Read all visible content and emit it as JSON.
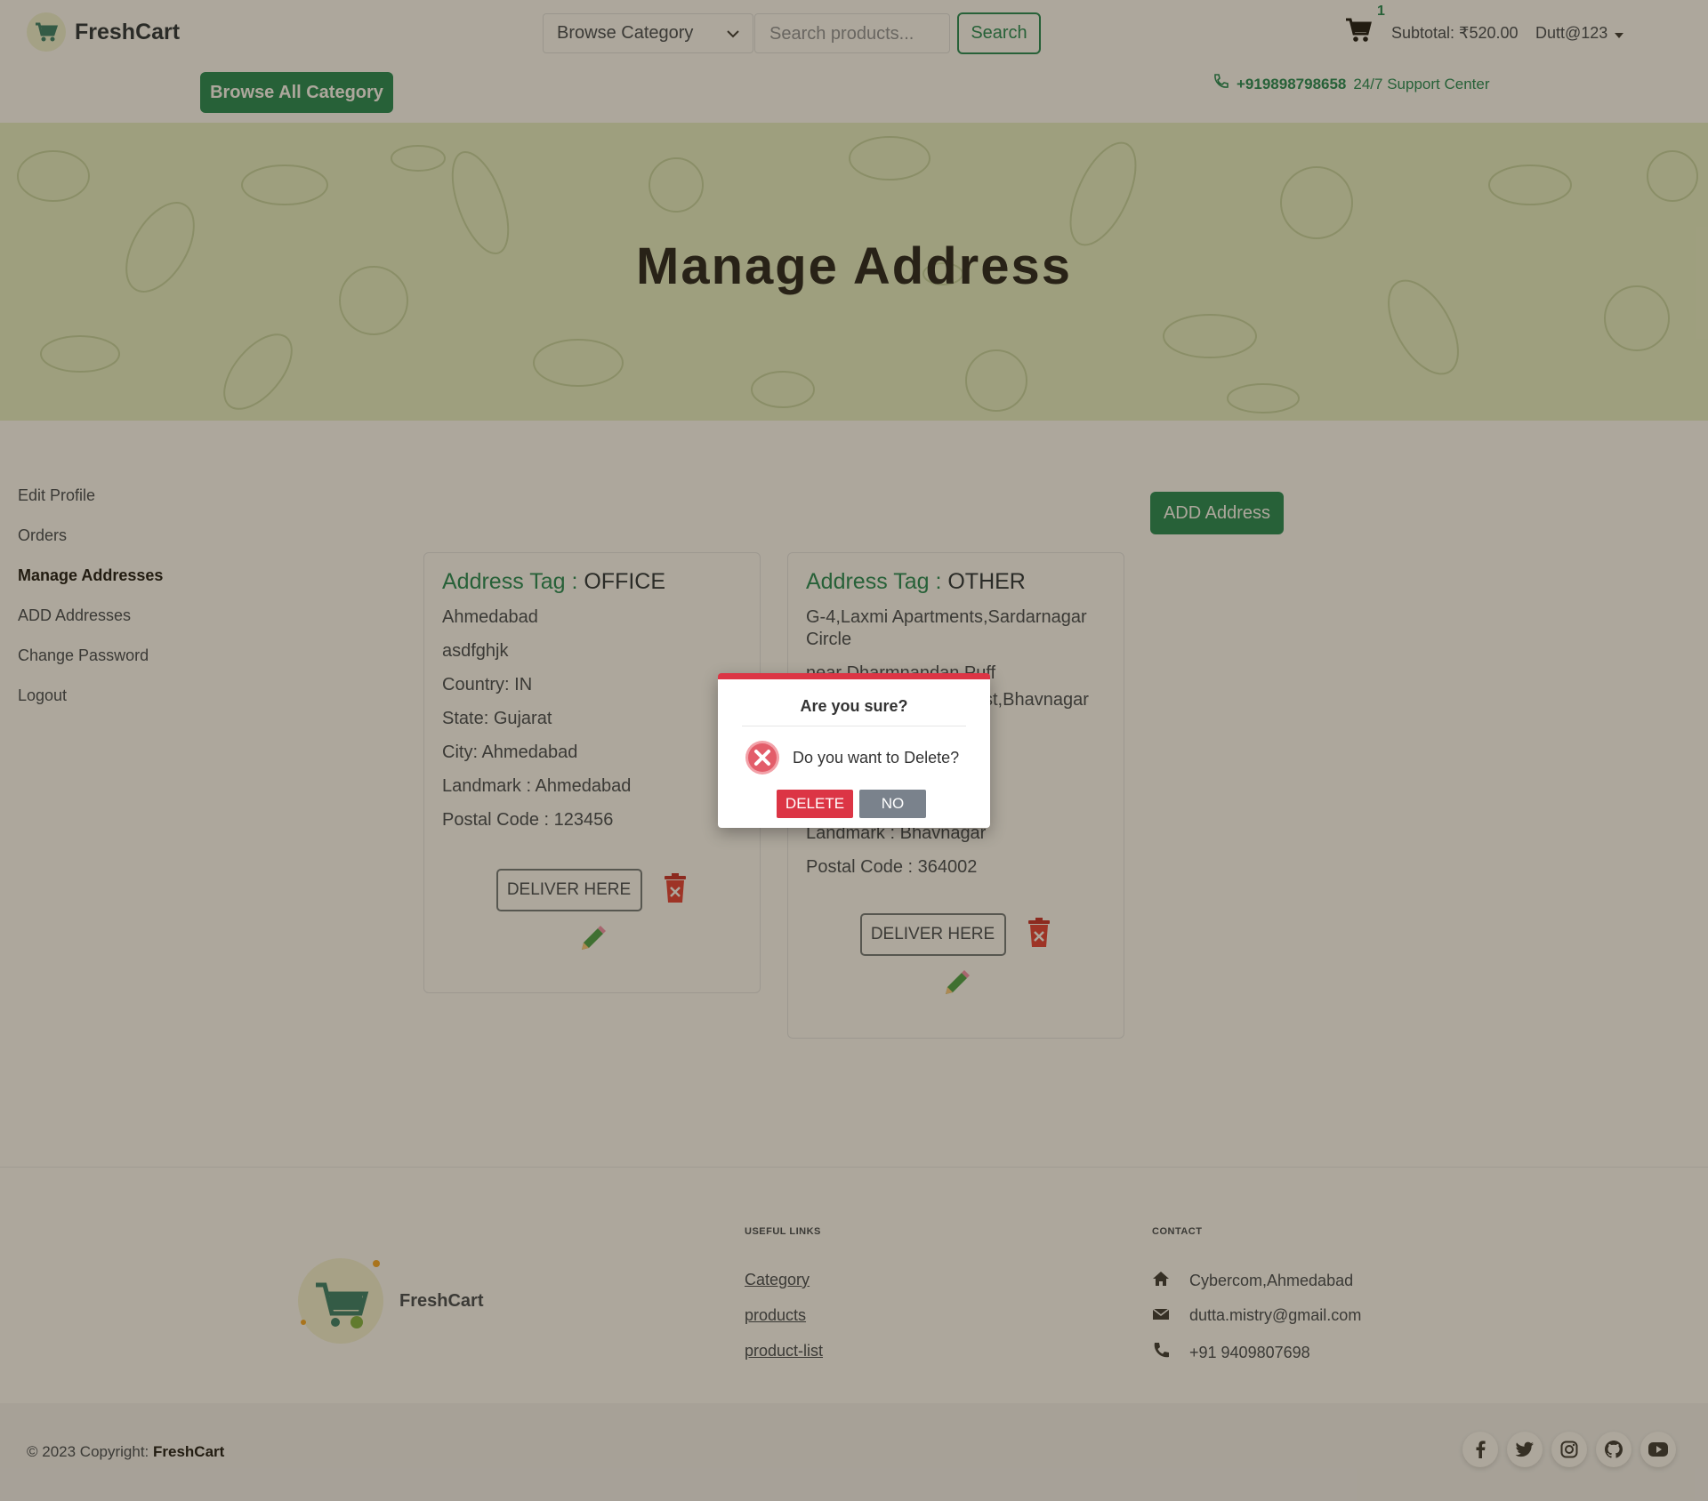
{
  "header": {
    "brand": "FreshCart",
    "category_select": "Browse Category",
    "search_placeholder": "Search products...",
    "search_label": "Search",
    "cart_count": "1",
    "subtotal": "Subtotal: ₹520.00",
    "user": "Dutt@123",
    "browse_all": "Browse All Category",
    "support_phone": "+919898798658",
    "support_text": "24/7 Support Center"
  },
  "banner": {
    "title": "Manage Address"
  },
  "sidebar": {
    "items": [
      {
        "label": "Edit Profile"
      },
      {
        "label": "Orders"
      },
      {
        "label": "Manage Addresses"
      },
      {
        "label": "ADD Addresses"
      },
      {
        "label": "Change Password"
      },
      {
        "label": "Logout"
      }
    ]
  },
  "main": {
    "add_address_label": "ADD Address",
    "tag_label": "Address Tag :",
    "deliver_label": "DELIVER HERE",
    "cards": [
      {
        "tag": "OFFICE",
        "lines": [
          "Ahmedabad",
          "asdfghjk",
          "Country: IN",
          "State: Gujarat",
          "City: Ahmedabad",
          "Landmark : Ahmedabad",
          "Postal Code : 123456"
        ]
      },
      {
        "tag": "OTHER",
        "lines": [
          "G-4,Laxmi Apartments,Sardarnagar Circle",
          "near Dharmnandan Puff",
          "st,Bhavnagar",
          "Landmark : Bhavnagar",
          "Postal Code : 364002"
        ]
      }
    ]
  },
  "footer": {
    "brand": "FreshCart",
    "useful_links_title": "USEFUL LINKS",
    "links": [
      "Category",
      "products",
      "product-list"
    ],
    "contact_title": "CONTACT",
    "contact": [
      "Cybercom,Ahmedabad",
      "dutta.mistry@gmail.com",
      "+91 9409807698"
    ],
    "copyright_prefix": "© 2023 Copyright:",
    "copyright_brand": "FreshCart"
  },
  "modal": {
    "title": "Are you sure?",
    "message": "Do you want to Delete?",
    "delete_label": "DELETE",
    "no_label": "NO"
  },
  "colors": {
    "brand_green": "#198754",
    "danger_red": "#dc3545",
    "banner_bg": "#e6f1cc"
  }
}
